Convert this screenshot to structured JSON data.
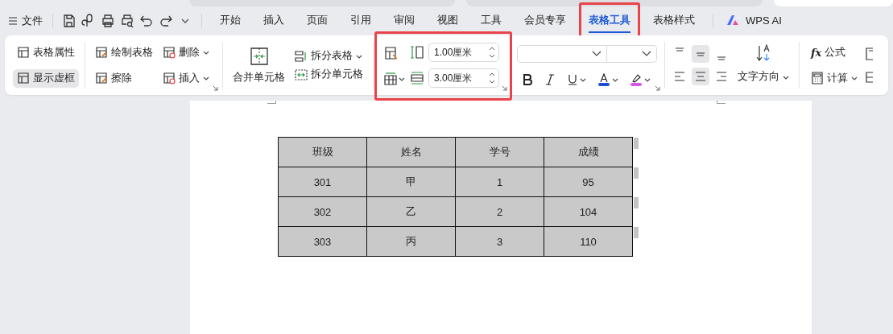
{
  "browser_tabs": [
    {
      "selected": false
    },
    {
      "selected": false
    },
    {
      "selected": true
    }
  ],
  "menubar": {
    "file_menu": "文件",
    "tabs": [
      {
        "label": "开始",
        "selected": false
      },
      {
        "label": "插入",
        "selected": false
      },
      {
        "label": "页面",
        "selected": false
      },
      {
        "label": "引用",
        "selected": false
      },
      {
        "label": "审阅",
        "selected": false
      },
      {
        "label": "视图",
        "selected": false
      },
      {
        "label": "工具",
        "selected": false
      },
      {
        "label": "会员专享",
        "selected": false
      },
      {
        "label": "表格工具",
        "selected": true
      },
      {
        "label": "表格样式",
        "selected": false
      }
    ],
    "ai_tab": "WPS AI"
  },
  "ribbon": {
    "table_group": [
      {
        "label": "表格属性",
        "on": false
      },
      {
        "label": "显示虚框",
        "on": true
      }
    ],
    "draw_group": [
      {
        "label": "绘制表格",
        "kind": "button"
      },
      {
        "label": "删除",
        "kind": "dropdown"
      },
      {
        "label": "擦除",
        "kind": "button"
      },
      {
        "label": "插入",
        "kind": "dropdown"
      }
    ],
    "merge_group": {
      "merge": "合并单元格",
      "split_table": "拆分表格",
      "split_cell": "拆分单元格"
    },
    "size_group": {
      "width": "1.00厘米",
      "height": "3.00厘米"
    },
    "align_buttons": [
      {
        "selected": false
      },
      {
        "selected": true
      },
      {
        "selected": false
      },
      {
        "selected": false
      },
      {
        "selected": true
      },
      {
        "selected": false
      }
    ],
    "text_direction": "文字方向",
    "formula_symbol": "fx",
    "formula": "公式",
    "calculate": "计算"
  },
  "document": {
    "table": {
      "columns": [
        "班级",
        "姓名",
        "学号",
        "成绩"
      ],
      "rows": [
        [
          "301",
          "甲",
          "1",
          "95"
        ],
        [
          "302",
          "乙",
          "2",
          "104"
        ],
        [
          "303",
          "丙",
          "3",
          "110"
        ]
      ]
    }
  }
}
